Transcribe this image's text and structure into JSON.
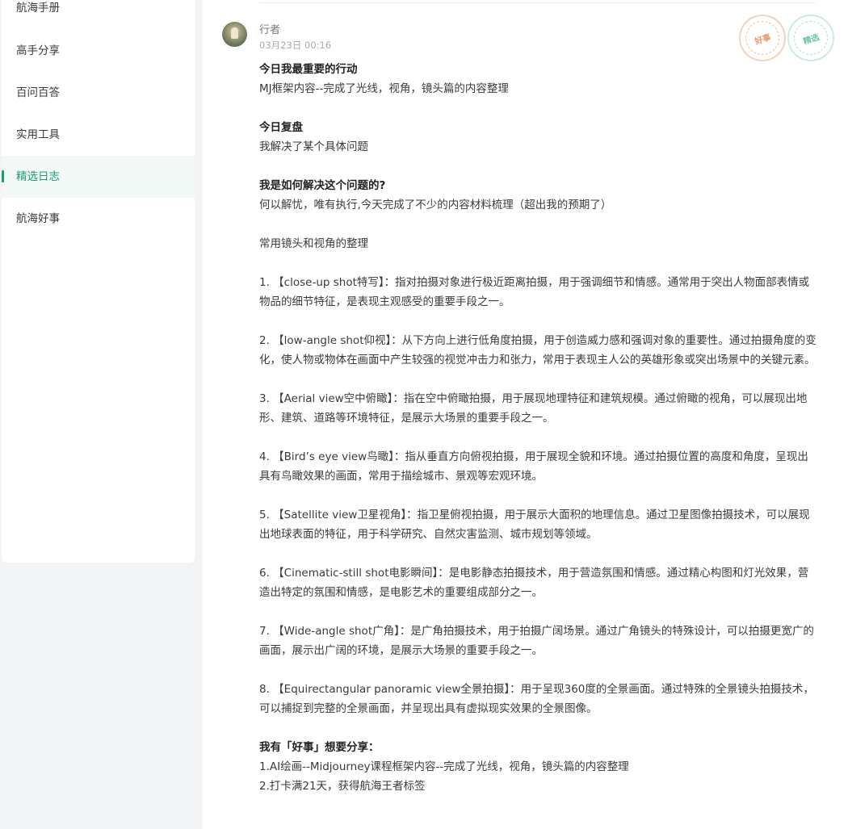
{
  "sidebar": {
    "items": [
      {
        "label": "航海手册",
        "active": false
      },
      {
        "label": "高手分享",
        "active": false
      },
      {
        "label": "百问百答",
        "active": false
      },
      {
        "label": "实用工具",
        "active": false
      },
      {
        "label": "精选日志",
        "active": true
      },
      {
        "label": "航海好事",
        "active": false
      }
    ]
  },
  "post": {
    "author": "行者",
    "date": "03月23日 00:16",
    "badges": {
      "good": "好事",
      "pick": "精选"
    },
    "accent_color": "#1f9c74",
    "sections": {
      "h1": "今日我最重要的行动",
      "p1": "MJ框架内容--完成了光线，视角，镜头篇的内容整理",
      "h2": "今日复盘",
      "p2": "我解决了某个具体问题",
      "h3": "我是如何解决这个问题的?",
      "p3": "何以解忧，唯有执行,今天完成了不少的内容材料梳理（超出我的预期了）",
      "p4": "常用镜头和视角的整理",
      "i1": "1. 【close-up shot特写】：指对拍摄对象进行极近距离拍摄，用于强调细节和情感。通常用于突出人物面部表情或物品的细节特征，是表现主观感受的重要手段之一。",
      "i2": "2. 【low-angle shot仰视】：从下方向上进行低角度拍摄，用于创造威力感和强调对象的重要性。通过拍摄角度的变化，使人物或物体在画面中产生较强的视觉冲击力和张力，常用于表现主人公的英雄形象或突出场景中的关键元素。",
      "i3": "3. 【Aerial view空中俯瞰】：指在空中俯瞰拍摄，用于展现地理特征和建筑规模。通过俯瞰的视角，可以展现出地形、建筑、道路等环境特征，是展示大场景的重要手段之一。",
      "i4": "4. 【Bird’s eye view鸟瞰】：指从垂直方向俯视拍摄，用于展现全貌和环境。通过拍摄位置的高度和角度，呈现出具有鸟瞰效果的画面，常用于描绘城市、景观等宏观环境。",
      "i5": "5. 【Satellite view卫星视角】：指卫星俯视拍摄，用于展示大面积的地理信息。通过卫星图像拍摄技术，可以展现出地球表面的特征，用于科学研究、自然灾害监测、城市规划等领域。",
      "i6": "6. 【Cinematic-still shot电影瞬间】：是电影静态拍摄技术，用于营造氛围和情感。通过精心构图和灯光效果，营造出特定的氛围和情感，是电影艺术的重要组成部分之一。",
      "i7": "7. 【Wide-angle shot广角】：是广角拍摄技术，用于拍摄广阔场景。通过广角镜头的特殊设计，可以拍摄更宽广的画面，展示出广阔的环境，是展示大场景的重要手段之一。",
      "i8": "8. 【Equirectangular panoramic view全景拍摄】：用于呈现360度的全景画面。通过特殊的全景镜头拍摄技术，可以捕捉到完整的全景画面，并呈现出具有虚拟现实效果的全景图像。",
      "h4": "我有「好事」想要分享：",
      "s1": "1.AI绘画--Midjourney课程框架内容--完成了光线，视角，镜头篇的内容整理",
      "s2": "2.打卡满21天，获得航海王者标签"
    }
  }
}
